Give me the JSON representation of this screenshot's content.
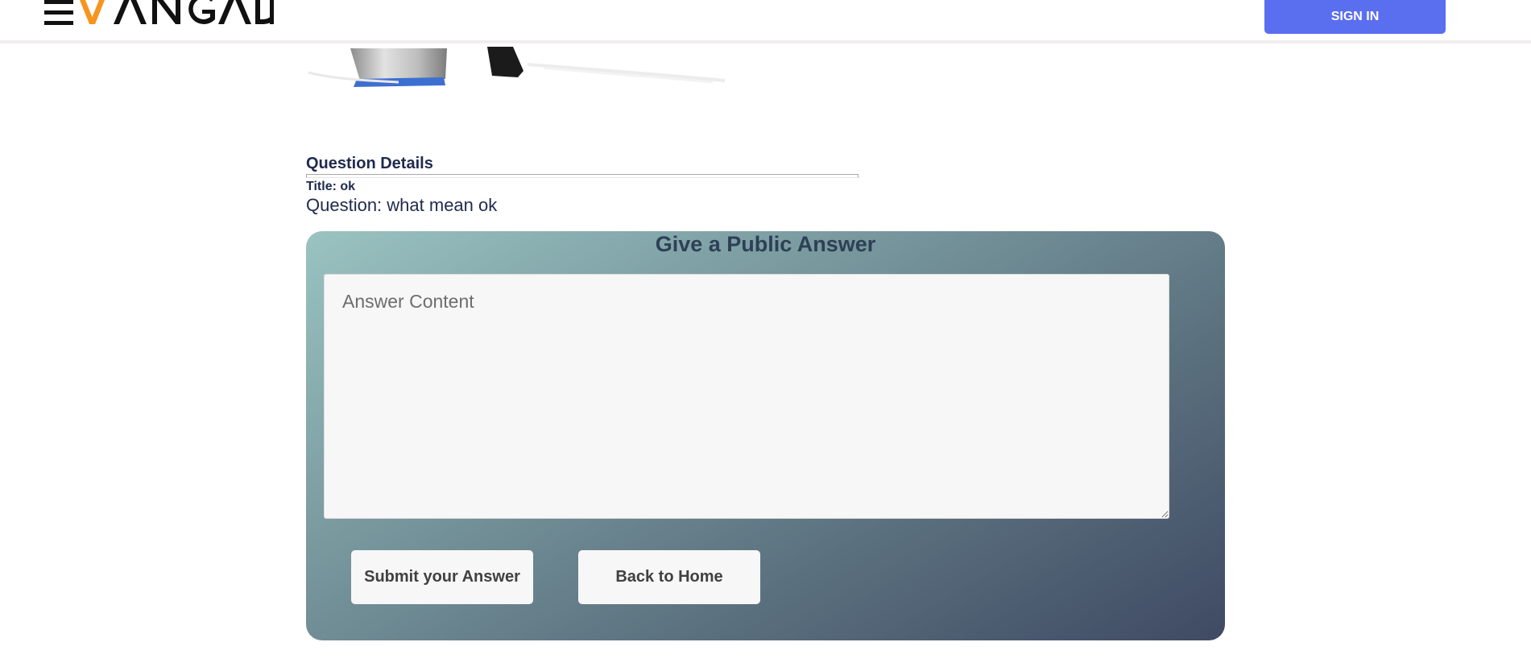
{
  "header": {
    "logo_text": "EVANGADI",
    "signin_label": "SIGN IN"
  },
  "question_details": {
    "heading": "Question Details",
    "title": "Title: ok",
    "question": "Question: what mean ok"
  },
  "answer_form": {
    "heading": "Give a Public Answer",
    "placeholder": "Answer Content",
    "submit_label": "Submit your Answer",
    "back_label": "Back to Home"
  },
  "colors": {
    "brand_orange": "#f7941d",
    "signin_blue": "#5a6ef0",
    "heading_navy": "#1f2a4d"
  }
}
